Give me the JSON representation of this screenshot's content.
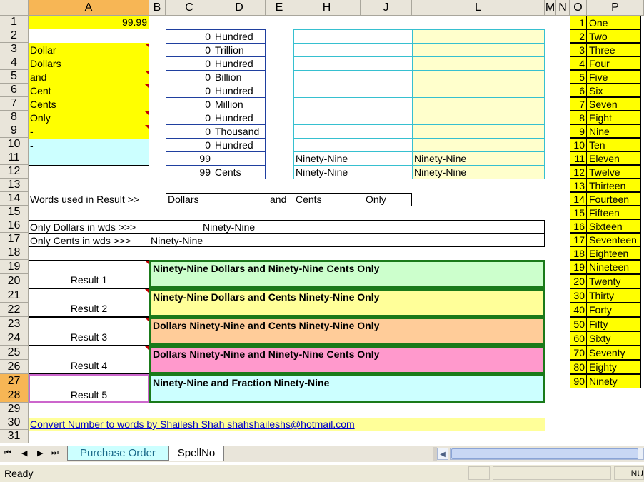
{
  "columns": [
    "A",
    "B",
    "C",
    "D",
    "E",
    "H",
    "J",
    "L",
    "M",
    "N",
    "O",
    "P"
  ],
  "rows": [
    "1",
    "2",
    "3",
    "4",
    "5",
    "6",
    "7",
    "8",
    "9",
    "10",
    "11",
    "12",
    "13",
    "14",
    "15",
    "16",
    "17",
    "18",
    "19",
    "20",
    "21",
    "22",
    "23",
    "24",
    "25",
    "26",
    "27",
    "28",
    "29",
    "30",
    "31"
  ],
  "a1_value": "99.99",
  "col_a_words": [
    "Dollar",
    "Dollars",
    "and",
    "Cent",
    "Cents",
    "Only",
    "-",
    "-"
  ],
  "c_values": [
    "0",
    "0",
    "0",
    "0",
    "0",
    "0",
    "0",
    "0",
    "0",
    "99",
    "99"
  ],
  "d_words": [
    "Hundred",
    "Trillion",
    "Hundred",
    "Billion",
    "Hundred",
    "Million",
    "Hundred",
    "Thousand",
    "Hundred",
    "",
    "Cents"
  ],
  "h11": "Ninety-Nine",
  "h12": "Ninety-Nine",
  "l11": "Ninety-Nine",
  "l12": "Ninety-Nine",
  "words_label": "Words used in Result  >>",
  "words_dollars": "Dollars",
  "words_and": "and",
  "words_cents": "Cents",
  "words_only": "Only",
  "only_dollars_label": "Only Dollars in wds  >>>",
  "only_dollars_value": "Ninety-Nine",
  "only_cents_label": "Only Cents in wds   >>>",
  "only_cents_value": "Ninety-Nine",
  "results": [
    {
      "label": "Result 1",
      "text": "Ninety-Nine Dollars and Ninety-Nine Cents Only",
      "color": "#ccffcc"
    },
    {
      "label": "Result 2",
      "text": "Ninety-Nine Dollars and Cents Ninety-Nine Only",
      "color": "#ffff99"
    },
    {
      "label": "Result 3",
      "text": "Dollars Ninety-Nine and Cents Ninety-Nine Only",
      "color": "#ffcc99"
    },
    {
      "label": "Result 4",
      "text": "Dollars Ninety-Nine and Ninety-Nine Cents Only",
      "color": "#ff99cc"
    },
    {
      "label": "Result 5",
      "text": "Ninety-Nine and Fraction Ninety-Nine",
      "color": "#ccffff"
    }
  ],
  "credit": "Convert Number to words by Shailesh Shah shahshaileshs@hotmail.com",
  "o_nums": [
    "1",
    "2",
    "3",
    "4",
    "5",
    "6",
    "7",
    "8",
    "9",
    "10",
    "11",
    "12",
    "13",
    "14",
    "15",
    "16",
    "17",
    "18",
    "19",
    "20",
    "30",
    "40",
    "50",
    "60",
    "70",
    "80",
    "90"
  ],
  "p_words": [
    "One",
    "Two",
    "Three",
    "Four",
    "Five",
    "Six",
    "Seven",
    "Eight",
    "Nine",
    "Ten",
    "Eleven",
    "Twelve",
    "Thirteen",
    "Fourteen",
    "Fifteen",
    "Sixteen",
    "Seventeen",
    "Eighteen",
    "Nineteen",
    "Twenty",
    "Thirty",
    "Forty",
    "Fifty",
    "Sixty",
    "Seventy",
    "Eighty",
    "Ninety"
  ],
  "tabs": [
    "Purchase Order",
    "SpellNo"
  ],
  "status_text": "Ready",
  "status_right": "NU",
  "colors": {
    "yellow": "#ffff00",
    "light_cyan": "#ccffff",
    "light_yellow": "#ffffcc",
    "credit_bg": "#ffff99",
    "link": "#0000cc"
  }
}
